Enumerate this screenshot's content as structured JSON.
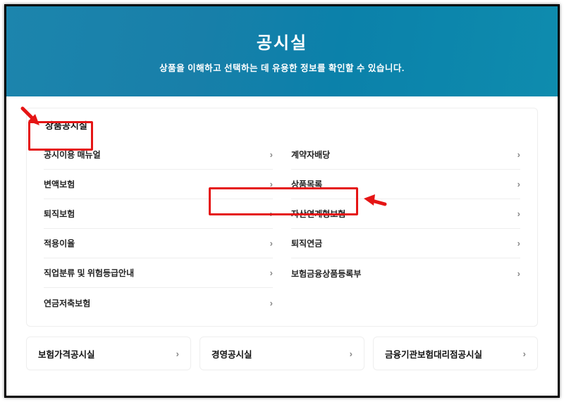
{
  "hero": {
    "title": "공시실",
    "subtitle": "상품을 이해하고 선택하는 데 유용한 정보를 확인할 수 있습니다."
  },
  "panel": {
    "head": "상품공시실",
    "left": [
      "공시이용 매뉴얼",
      "변액보험",
      "퇴직보험",
      "적용이율",
      "직업분류 및 위험등급안내",
      "연금저축보험"
    ],
    "right": [
      "계약자배당",
      "상품목록",
      "자산연계형보험",
      "퇴직연금",
      "보험금융상품등록부"
    ]
  },
  "bottom": [
    "보험가격공시실",
    "경영공시실",
    "금융기관보험대리점공시실"
  ],
  "chevron": "›"
}
